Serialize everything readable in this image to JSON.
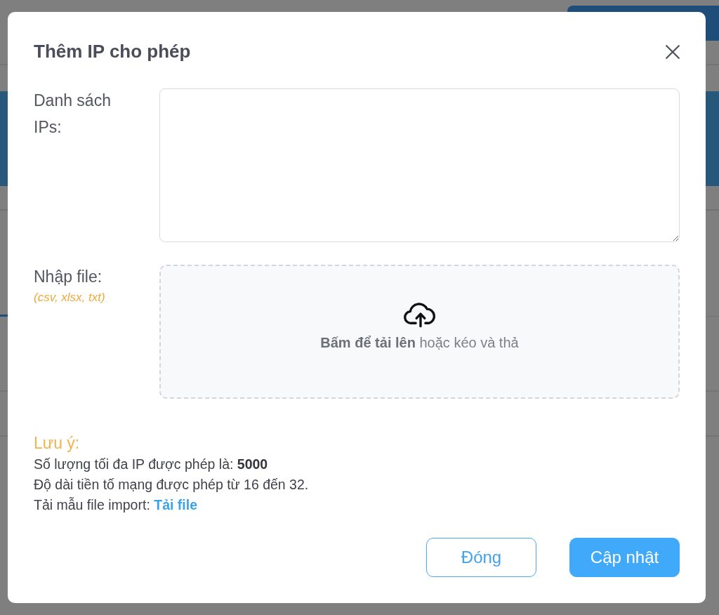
{
  "modal": {
    "title": "Thêm IP cho phép"
  },
  "fields": [
    {
      "kind": "textarea",
      "label": "Danh sách IPs:"
    },
    {
      "kind": "dropzone",
      "label": "Nhập file:",
      "hint": "(csv, xlsx, txt)",
      "prompt": "**Bấm để tải lên** hoặc kéo và thả"
    }
  ],
  "note": {
    "heading": "Lưu ý:",
    "lines": [
      {
        "text": "Số lượng tối đa IP được phép là: **5000**"
      },
      {
        "text": "Độ dài tiền tố mạng được phép từ 16 đến 32."
      },
      {
        "text": "Tải mẫu file import:",
        "link": "Tải file"
      }
    ]
  },
  "buttons": [
    {
      "kind": "secondary",
      "label": "Đóng"
    },
    {
      "kind": "primary",
      "label": "Cập nhật"
    }
  ]
}
